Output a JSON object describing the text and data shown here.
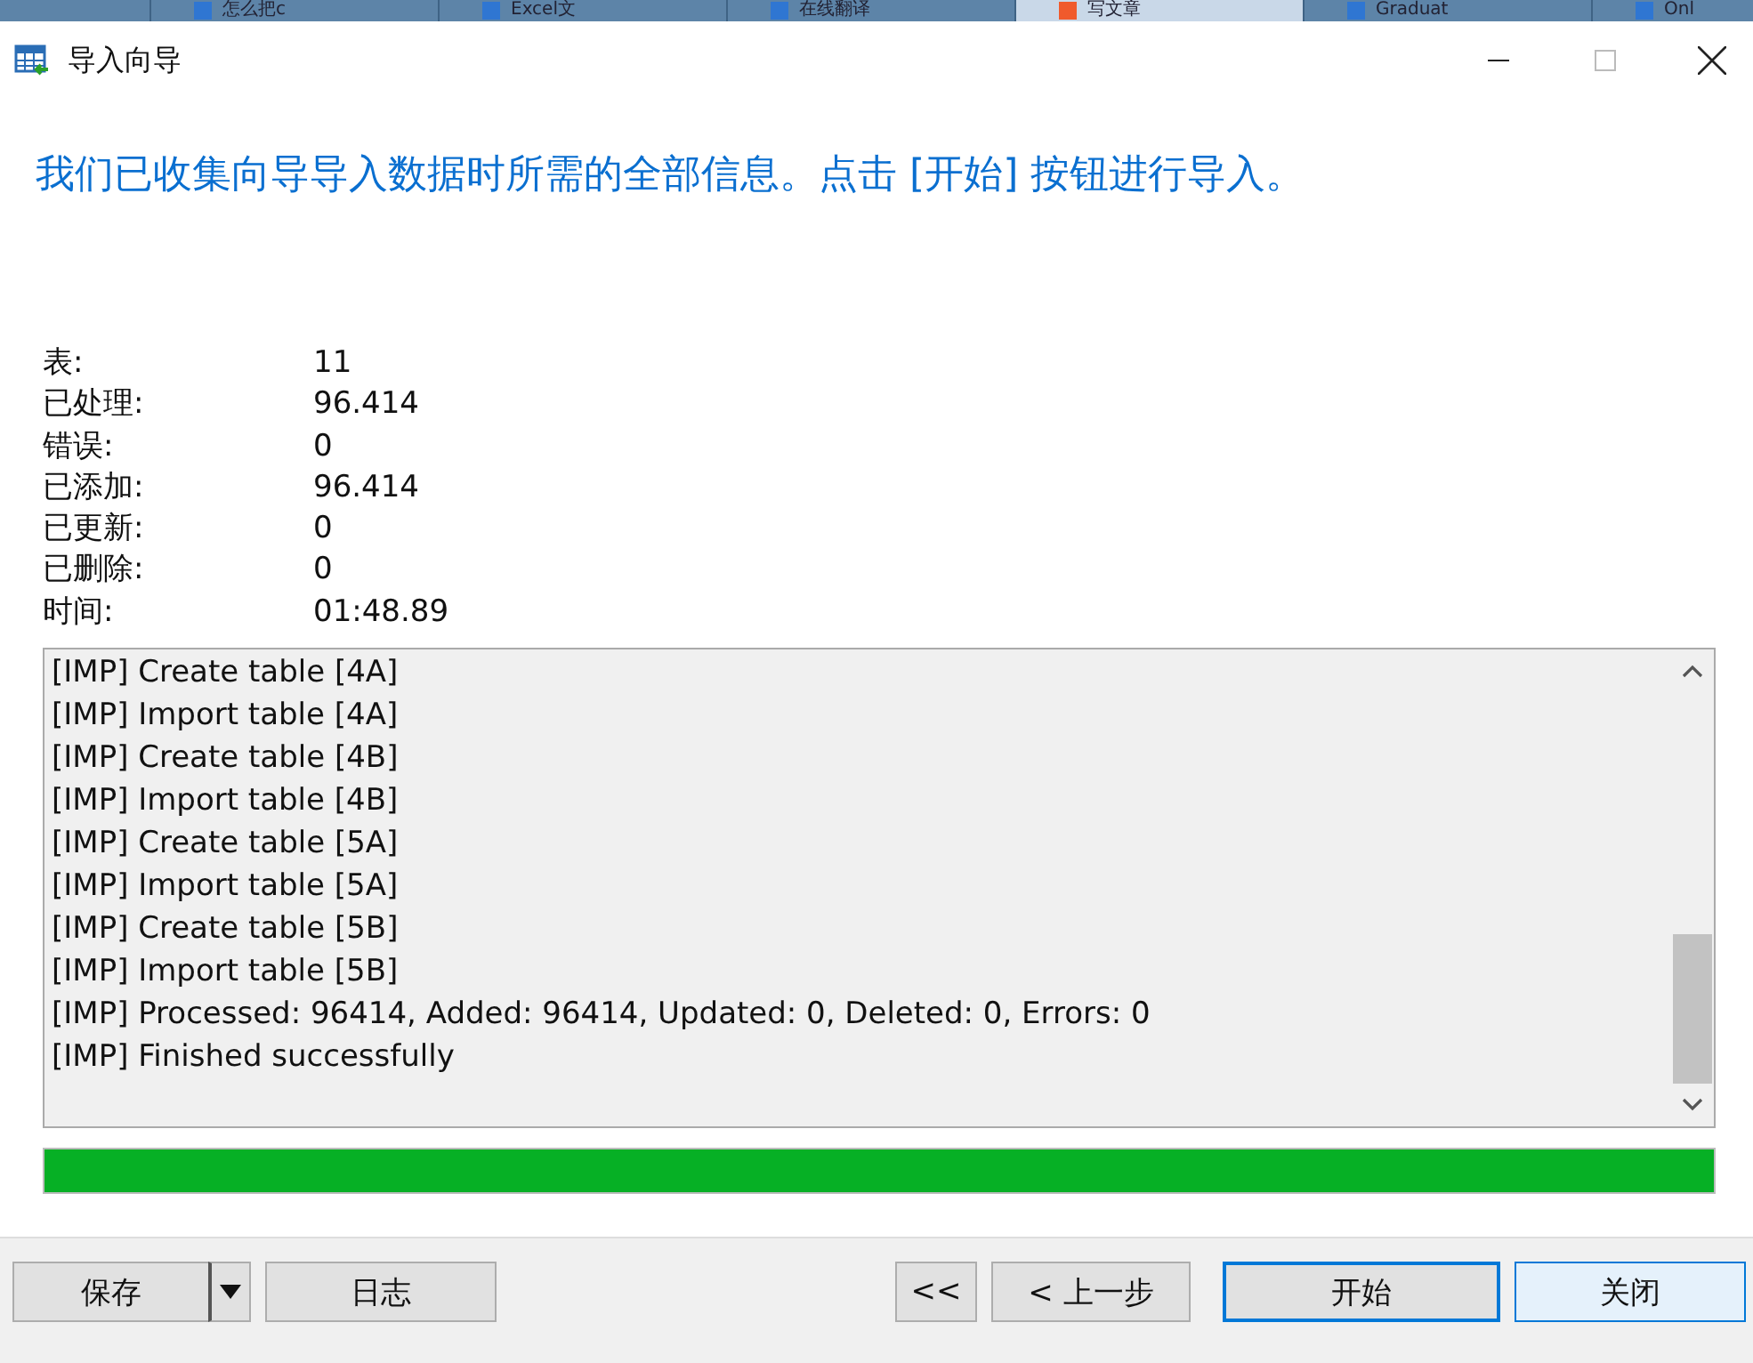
{
  "browser_tabs": [
    {
      "label": "怎么把c",
      "selected": false
    },
    {
      "label": "Excel文",
      "selected": false
    },
    {
      "label": "在线翻译",
      "selected": false
    },
    {
      "label": "写文章",
      "selected": true
    },
    {
      "label": "Graduat",
      "selected": false
    },
    {
      "label": "Onl",
      "selected": false
    }
  ],
  "window": {
    "title": "导入向导"
  },
  "heading": "我们已收集向导导入数据时所需的全部信息。点击 [开始] 按钮进行导入。",
  "stats": [
    {
      "label": "表:",
      "value": "11"
    },
    {
      "label": "已处理:",
      "value": "96.414"
    },
    {
      "label": "错误:",
      "value": "0"
    },
    {
      "label": "已添加:",
      "value": "96.414"
    },
    {
      "label": "已更新:",
      "value": "0"
    },
    {
      "label": "已删除:",
      "value": "0"
    },
    {
      "label": "时间:",
      "value": "01:48.89"
    }
  ],
  "log": [
    "[IMP] Create table [4A]",
    "[IMP] Import table [4A]",
    "[IMP] Create table [4B]",
    "[IMP] Import table [4B]",
    "[IMP] Create table [5A]",
    "[IMP] Import table [5A]",
    "[IMP] Create table [5B]",
    "[IMP] Import table [5B]",
    "[IMP] Processed: 96414, Added: 96414, Updated: 0, Deleted: 0, Errors: 0",
    "[IMP] Finished successfully"
  ],
  "progress": {
    "level": 1
  },
  "buttons_left": [
    {
      "label": "保存",
      "kind": "split"
    },
    {
      "label": "日志",
      "kind": "plain"
    }
  ],
  "buttons_right": [
    {
      "label": "<<",
      "kind": "plain"
    },
    {
      "label": "< 上一步",
      "kind": "plain"
    },
    {
      "label": "开始",
      "kind": "default"
    },
    {
      "label": "关闭",
      "kind": "hover"
    }
  ]
}
